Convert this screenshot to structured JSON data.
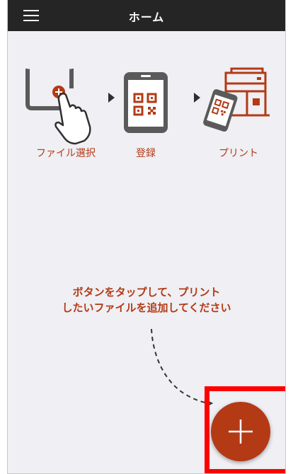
{
  "header": {
    "title": "ホーム",
    "menu_icon": "hamburger-menu-icon"
  },
  "steps": [
    {
      "label": "ファイル選択",
      "icon": "tablet-tap-icon"
    },
    {
      "label": "登録",
      "icon": "qr-phone-icon"
    },
    {
      "label": "プリント",
      "icon": "printer-qr-icon"
    }
  ],
  "instruction": {
    "line1": "ボタンをタップして、プリント",
    "line2": "したいファイルを追加してください"
  },
  "fab": {
    "icon": "plus-icon"
  },
  "colors": {
    "accent": "#b33a14",
    "header_bg": "#252525",
    "background": "#efeff4",
    "highlight": "#ff0000"
  }
}
